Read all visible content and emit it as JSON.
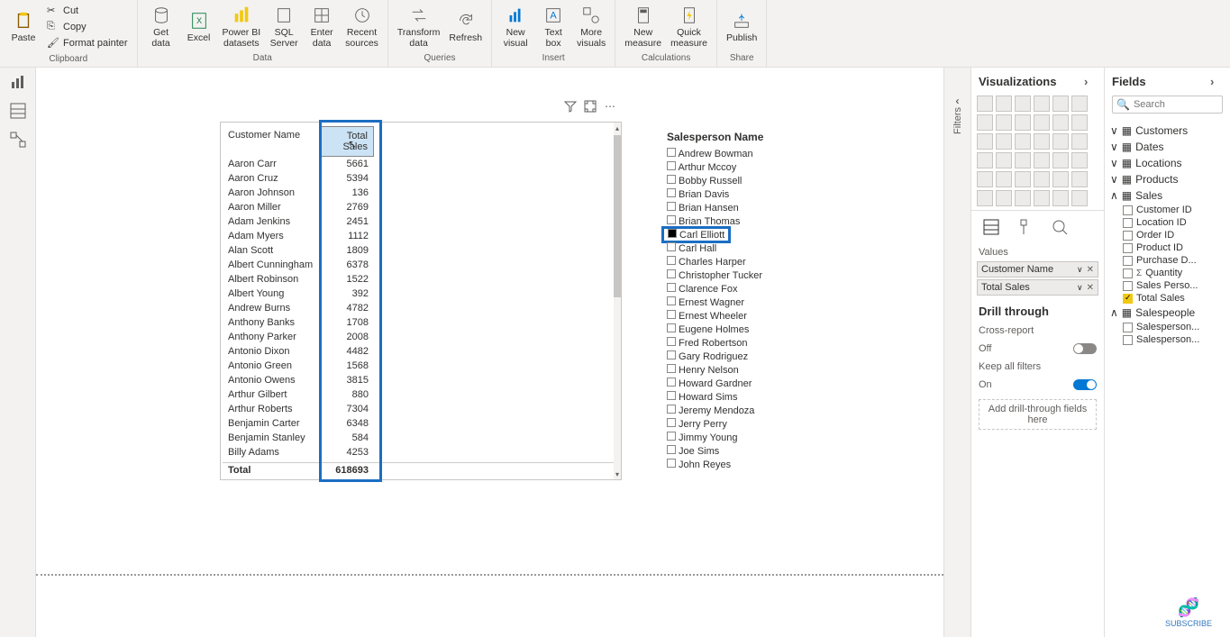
{
  "ribbon": {
    "clipboard": {
      "paste": "Paste",
      "cut": "Cut",
      "copy": "Copy",
      "painter": "Format painter",
      "label": "Clipboard"
    },
    "data": {
      "get": "Get\ndata",
      "excel": "Excel",
      "pbids": "Power BI\ndatasets",
      "sql": "SQL\nServer",
      "enter": "Enter\ndata",
      "recent": "Recent\nsources",
      "label": "Data"
    },
    "queries": {
      "transform": "Transform\ndata",
      "refresh": "Refresh",
      "label": "Queries"
    },
    "insert": {
      "newvis": "New\nvisual",
      "textbox": "Text\nbox",
      "more": "More\nvisuals",
      "label": "Insert"
    },
    "calc": {
      "newmeasure": "New\nmeasure",
      "quickmeasure": "Quick\nmeasure",
      "label": "Calculations"
    },
    "share": {
      "publish": "Publish",
      "label": "Share"
    }
  },
  "filtersRail": "Filters",
  "visPane": {
    "title": "Visualizations",
    "values": "Values",
    "well": {
      "customer": "Customer Name",
      "total": "Total Sales"
    },
    "drill": "Drill through",
    "cross": "Cross-report",
    "crossState": "Off",
    "keep": "Keep all filters",
    "keepState": "On",
    "dropHint": "Add drill-through fields here"
  },
  "fieldsPane": {
    "title": "Fields",
    "searchPlaceholder": "Search",
    "tables": {
      "customers": "Customers",
      "dates": "Dates",
      "locations": "Locations",
      "products": "Products",
      "sales": "Sales",
      "salespeople": "Salespeople"
    },
    "salesFields": {
      "custId": "Customer ID",
      "locId": "Location ID",
      "orderId": "Order ID",
      "prodId": "Product ID",
      "purchDate": "Purchase D...",
      "qty": "Quantity",
      "salesPers": "Sales Perso...",
      "total": "Total Sales"
    },
    "spFields": {
      "f1": "Salesperson...",
      "f2": "Salesperson..."
    }
  },
  "table": {
    "col1": "Customer Name",
    "col2": "Total Sales",
    "rows": [
      {
        "n": "Aaron Carr",
        "v": "5661"
      },
      {
        "n": "Aaron Cruz",
        "v": "5394"
      },
      {
        "n": "Aaron Johnson",
        "v": "136"
      },
      {
        "n": "Aaron Miller",
        "v": "2769"
      },
      {
        "n": "Adam Jenkins",
        "v": "2451"
      },
      {
        "n": "Adam Myers",
        "v": "1112"
      },
      {
        "n": "Alan Scott",
        "v": "1809"
      },
      {
        "n": "Albert Cunningham",
        "v": "6378"
      },
      {
        "n": "Albert Robinson",
        "v": "1522"
      },
      {
        "n": "Albert Young",
        "v": "392"
      },
      {
        "n": "Andrew Burns",
        "v": "4782"
      },
      {
        "n": "Anthony Banks",
        "v": "1708"
      },
      {
        "n": "Anthony Parker",
        "v": "2008"
      },
      {
        "n": "Antonio Dixon",
        "v": "4482"
      },
      {
        "n": "Antonio Green",
        "v": "1568"
      },
      {
        "n": "Antonio Owens",
        "v": "3815"
      },
      {
        "n": "Arthur Gilbert",
        "v": "880"
      },
      {
        "n": "Arthur Roberts",
        "v": "7304"
      },
      {
        "n": "Benjamin Carter",
        "v": "6348"
      },
      {
        "n": "Benjamin Stanley",
        "v": "584"
      },
      {
        "n": "Billy Adams",
        "v": "4253"
      }
    ],
    "totalLabel": "Total",
    "totalValue": "618693"
  },
  "slicer": {
    "title": "Salesperson Name",
    "items": [
      "Andrew Bowman",
      "Arthur Mccoy",
      "Bobby Russell",
      "Brian Davis",
      "Brian Hansen",
      "Brian Thomas",
      "Carl Elliott",
      "Carl Hall",
      "Charles Harper",
      "Christopher Tucker",
      "Clarence Fox",
      "Ernest Wagner",
      "Ernest Wheeler",
      "Eugene Holmes",
      "Fred Robertson",
      "Gary Rodriguez",
      "Henry Nelson",
      "Howard Gardner",
      "Howard Sims",
      "Jeremy Mendoza",
      "Jerry Perry",
      "Jimmy Young",
      "Joe Sims",
      "John Reyes"
    ],
    "highlightIndex": 6
  },
  "footer": "SUBSCRIBE"
}
